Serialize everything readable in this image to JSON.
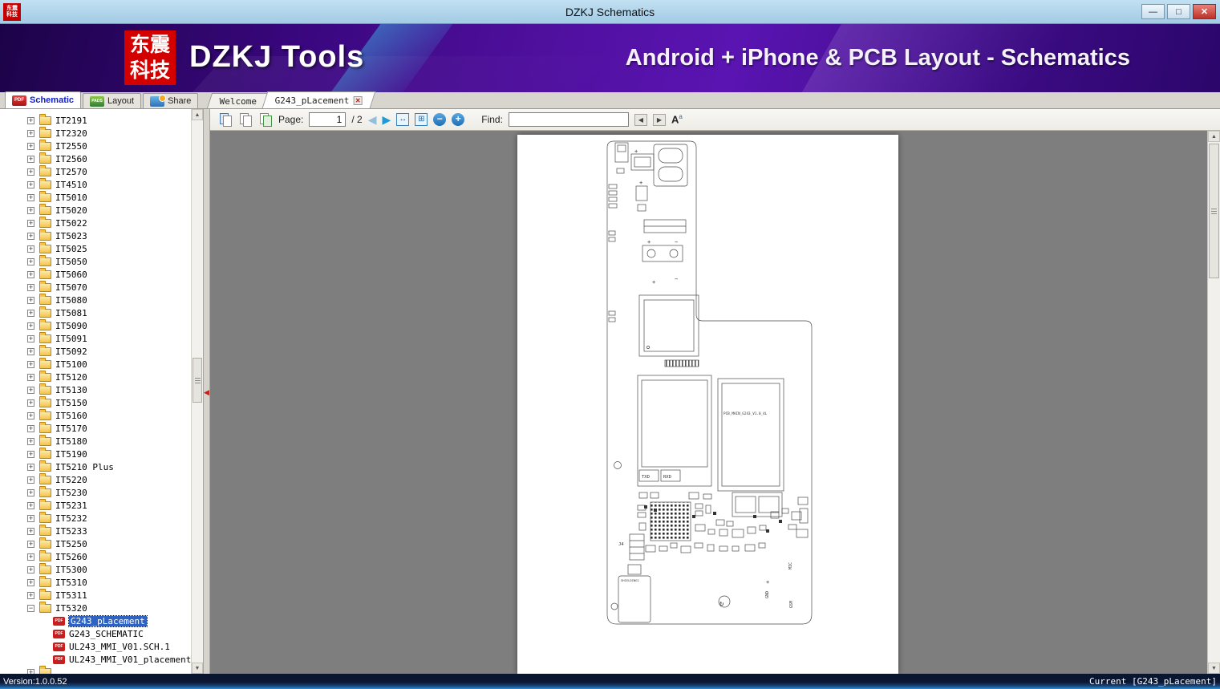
{
  "window": {
    "title": "DZKJ Schematics"
  },
  "banner": {
    "logo_line1": "东震",
    "logo_line2": "科技",
    "app_name": "DZKJ Tools",
    "subtitle": "Android + iPhone & PCB Layout - Schematics"
  },
  "main_tabs": [
    {
      "label": "Schematic",
      "icon": "pdf-icon"
    },
    {
      "label": "Layout",
      "icon": "pads-icon"
    },
    {
      "label": "Share",
      "icon": "share-icon"
    }
  ],
  "doc_tabs": {
    "welcome": "Welcome",
    "active": "G243_pLacement"
  },
  "toolbar": {
    "page_label": "Page:",
    "page_value": "1",
    "page_total": "/ 2",
    "find_label": "Find:",
    "find_value": ""
  },
  "tree": {
    "folders": [
      {
        "label": "IT2191"
      },
      {
        "label": "IT2320"
      },
      {
        "label": "IT2550"
      },
      {
        "label": "IT2560"
      },
      {
        "label": "IT2570"
      },
      {
        "label": "IT4510"
      },
      {
        "label": "IT5010"
      },
      {
        "label": "IT5020"
      },
      {
        "label": "IT5022"
      },
      {
        "label": "IT5023"
      },
      {
        "label": "IT5025"
      },
      {
        "label": "IT5050"
      },
      {
        "label": "IT5060"
      },
      {
        "label": "IT5070"
      },
      {
        "label": "IT5080"
      },
      {
        "label": "IT5081"
      },
      {
        "label": "IT5090"
      },
      {
        "label": "IT5091"
      },
      {
        "label": "IT5092"
      },
      {
        "label": "IT5100"
      },
      {
        "label": "IT5120"
      },
      {
        "label": "IT5130"
      },
      {
        "label": "IT5150"
      },
      {
        "label": "IT5160"
      },
      {
        "label": "IT5170"
      },
      {
        "label": "IT5180"
      },
      {
        "label": "IT5190"
      },
      {
        "label": "IT5210 Plus"
      },
      {
        "label": "IT5220"
      },
      {
        "label": "IT5230"
      },
      {
        "label": "IT5231"
      },
      {
        "label": "IT5232"
      },
      {
        "label": "IT5233"
      },
      {
        "label": "IT5250"
      },
      {
        "label": "IT5260"
      },
      {
        "label": "IT5300"
      },
      {
        "label": "IT5310"
      },
      {
        "label": "IT5311"
      },
      {
        "label": "IT5320",
        "expanded": true,
        "children": [
          {
            "label": "G243_pLacement",
            "selected": true
          },
          {
            "label": "G243_SCHEMATIC"
          },
          {
            "label": "UL243_MMI_V01.SCH.1"
          },
          {
            "label": "UL243_MMI_V01_placement"
          }
        ]
      },
      {
        "label": ""
      }
    ]
  },
  "pcb": {
    "board_name": "PCB_MAIN_G243_V1.0_4L",
    "labels": {
      "txd": "TXD",
      "rxd": "RXD",
      "shielding": "SHIELDING1",
      "j4": "J4",
      "gnd": "GND",
      "gsm": "GSM",
      "mic": "MIC",
      "plus": "+",
      "minus": "−"
    }
  },
  "statusbar": {
    "left": "Version:1.0.0.52",
    "right": "Current [G243_pLacement]"
  },
  "icons": {
    "minimize": "—",
    "maximize": "□",
    "close": "✕",
    "back": "◀",
    "forward": "▶",
    "fit_width": "↔",
    "fit_page": "⊞",
    "zoom_out": "−",
    "zoom_in": "+",
    "find_prev": "◀",
    "find_next": "▶",
    "case_a": "A",
    "case_sup": "a",
    "scroll_up": "▲",
    "scroll_down": "▼",
    "splitter": "◀",
    "rotate": "↻",
    "tab_close": "✕",
    "expand": "+",
    "collapse": "−",
    "pdf_label": "PDF",
    "pads_label": "PADS"
  }
}
